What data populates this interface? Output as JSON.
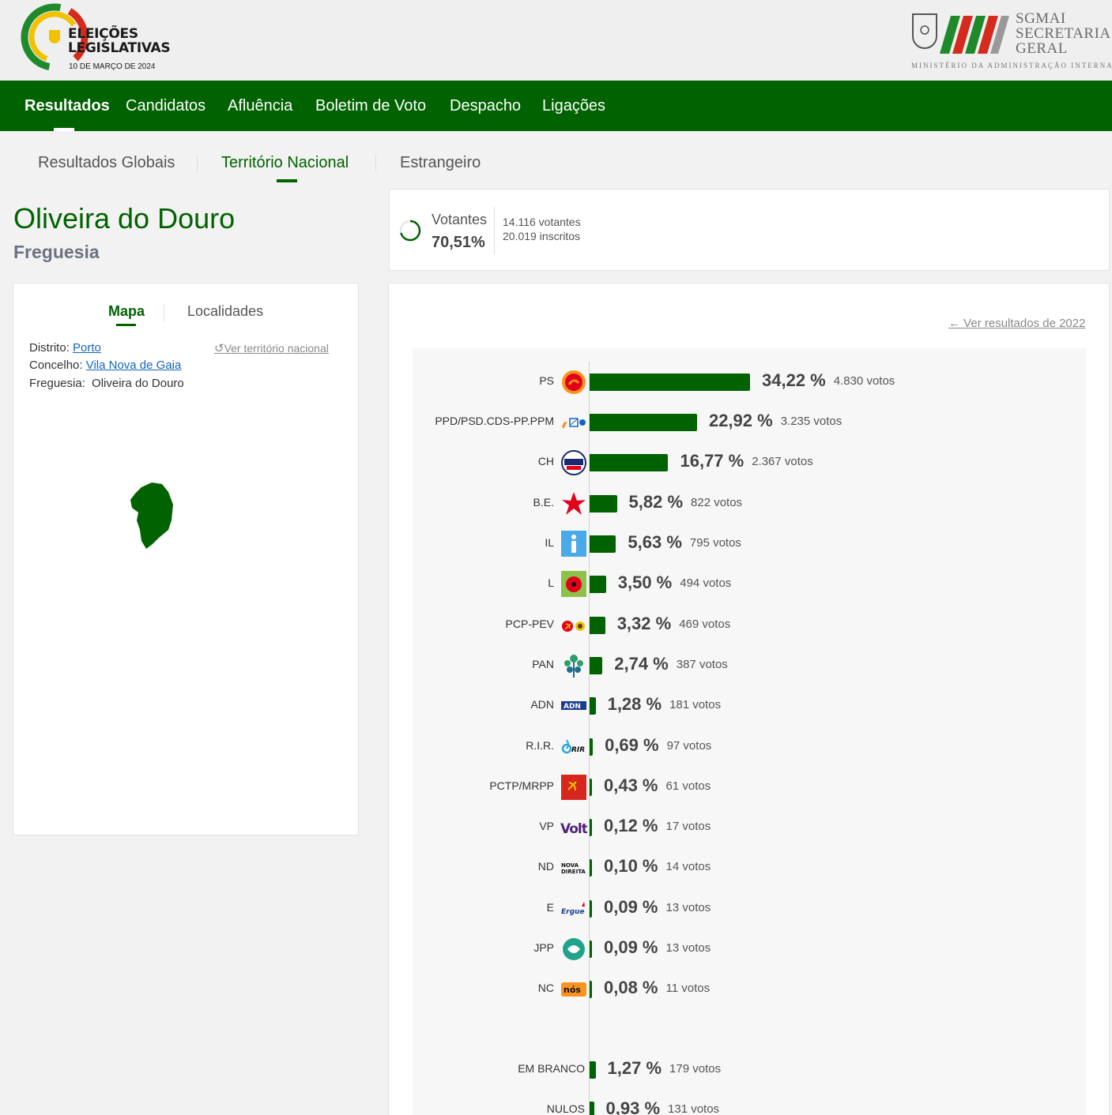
{
  "header": {
    "logo_line1": "ELEIÇÕES",
    "logo_line2": "LEGISLATIVAS",
    "logo_date": "10 DE MARÇO DE 2024",
    "sgmai_1": "SGMAI",
    "sgmai_2": "SECRETARIA",
    "sgmai_3": "GERAL",
    "ministry": "MINISTÉRIO DA ADMINISTRAÇÃO INTERNA"
  },
  "nav": [
    {
      "label": "Resultados"
    },
    {
      "label": "Candidatos"
    },
    {
      "label": "Afluência"
    },
    {
      "label": "Boletim de Voto"
    },
    {
      "label": "Despacho"
    },
    {
      "label": "Ligações"
    }
  ],
  "subtabs": [
    {
      "label": "Resultados Globais"
    },
    {
      "label": "Território Nacional"
    },
    {
      "label": "Estrangeiro"
    }
  ],
  "place": {
    "name": "Oliveira do Douro",
    "type": "Freguesia"
  },
  "voters": {
    "label": "Votantes",
    "pct": "70,51%",
    "pct_value": 70.51,
    "count": "14.116 votantes",
    "registered": "20.019 inscritos"
  },
  "map_card": {
    "tab_map": "Mapa",
    "tab_localities": "Localidades",
    "district_label": "Distrito:",
    "district": "Porto",
    "council_label": "Concelho:",
    "council": "Vila Nova de Gaia",
    "parish_label": "Freguesia:",
    "parish": "Oliveira do Douro",
    "national_link": "Ver território nacional"
  },
  "results": {
    "prev_link": "Ver resultados de 2022",
    "parties": [
      {
        "name": "PS",
        "pct": "34,22 %",
        "value": 34.22,
        "votes": "4.830 votos",
        "logo": "ps-logo"
      },
      {
        "name": "PPD/PSD.CDS-PP.PPM",
        "pct": "22,92 %",
        "value": 22.92,
        "votes": "3.235 votos",
        "logo": "ad-logo"
      },
      {
        "name": "CH",
        "pct": "16,77 %",
        "value": 16.77,
        "votes": "2.367 votos",
        "logo": "chega-logo"
      },
      {
        "name": "B.E.",
        "pct": "5,82 %",
        "value": 5.82,
        "votes": "822 votos",
        "logo": "be-logo"
      },
      {
        "name": "IL",
        "pct": "5,63 %",
        "value": 5.63,
        "votes": "795 votos",
        "logo": "il-logo"
      },
      {
        "name": "L",
        "pct": "3,50 %",
        "value": 3.5,
        "votes": "494 votos",
        "logo": "livre-logo"
      },
      {
        "name": "PCP-PEV",
        "pct": "3,32 %",
        "value": 3.32,
        "votes": "469 votos",
        "logo": "cdu-logo"
      },
      {
        "name": "PAN",
        "pct": "2,74 %",
        "value": 2.74,
        "votes": "387 votos",
        "logo": "pan-logo"
      },
      {
        "name": "ADN",
        "pct": "1,28 %",
        "value": 1.28,
        "votes": "181 votos",
        "logo": "adn-logo"
      },
      {
        "name": "R.I.R.",
        "pct": "0,69 %",
        "value": 0.69,
        "votes": "97 votos",
        "logo": "rir-logo"
      },
      {
        "name": "PCTP/MRPP",
        "pct": "0,43 %",
        "value": 0.43,
        "votes": "61 votos",
        "logo": "pctp-logo"
      },
      {
        "name": "VP",
        "pct": "0,12 %",
        "value": 0.12,
        "votes": "17 votos",
        "logo": "volt-logo"
      },
      {
        "name": "ND",
        "pct": "0,10 %",
        "value": 0.1,
        "votes": "14 votos",
        "logo": "nd-logo"
      },
      {
        "name": "E",
        "pct": "0,09 %",
        "value": 0.09,
        "votes": "13 votos",
        "logo": "ergue-te-logo"
      },
      {
        "name": "JPP",
        "pct": "0,09 %",
        "value": 0.09,
        "votes": "13 votos",
        "logo": "jpp-logo"
      },
      {
        "name": "NC",
        "pct": "0,08 %",
        "value": 0.08,
        "votes": "11 votos",
        "logo": "nos-logo"
      }
    ],
    "others": [
      {
        "name": "EM BRANCO",
        "pct": "1,27 %",
        "value": 1.27,
        "votes": "179 votos"
      },
      {
        "name": "NULOS",
        "pct": "0,93 %",
        "value": 0.93,
        "votes": "131 votos"
      }
    ]
  },
  "colors": {
    "brand_green": "#006200",
    "link_blue": "#1565c0"
  }
}
